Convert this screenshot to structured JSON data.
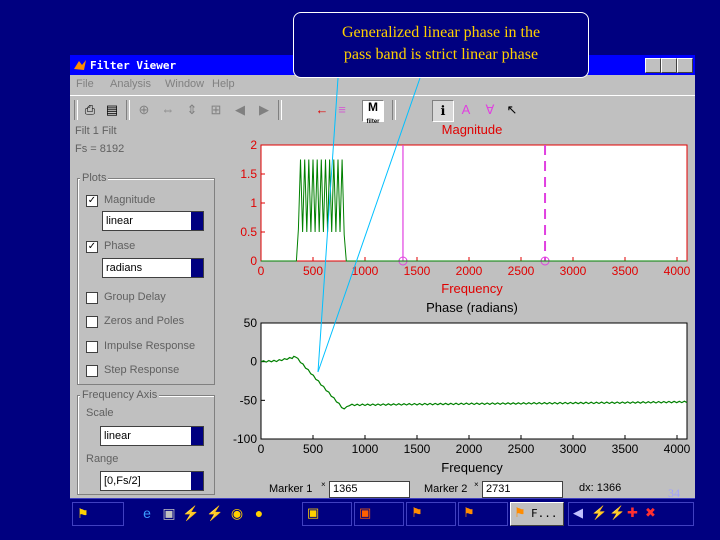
{
  "window": {
    "title": "Filter Viewer",
    "menu": [
      "File",
      "Analysis",
      "Window",
      "Help"
    ]
  },
  "toolbar": {
    "icons": [
      "print-icon",
      "print-preview-icon",
      "zoom-in-icon",
      "zoom-x-icon",
      "zoom-y-icon",
      "full-view-icon",
      "pan-left-icon",
      "pan-right-icon",
      "marker-left-icon",
      "signal-icon",
      "mri-icon",
      "info-icon",
      "marker-a-icon",
      "marker-b-icon",
      "pointer-icon"
    ],
    "mri_label": "M",
    "mri_sub": "filter"
  },
  "left_panel": {
    "filter_name": "Filt 1 Filt",
    "filter_fs": "Fs = 8192",
    "plots_heading": "Plots",
    "magnitude": {
      "label": "Magnitude",
      "checked": true,
      "mode": "linear"
    },
    "phase": {
      "label": "Phase",
      "checked": true,
      "mode": "radians"
    },
    "group_delay": {
      "label": "Group Delay",
      "checked": false
    },
    "zeros_poles": {
      "label": "Zeros and Poles",
      "checked": false
    },
    "impulse": {
      "label": "Impulse Response",
      "checked": false
    },
    "step": {
      "label": "Step Response",
      "checked": false
    },
    "freq_axis_heading": "Frequency Axis",
    "scale_label": "Scale",
    "scale_value": "linear",
    "range_label": "Range",
    "range_value": "[0,Fs/2]"
  },
  "markers": {
    "marker1_label": "Marker 1",
    "marker1_value": "1365",
    "marker2_label": "Marker 2",
    "marker2_value": "2731",
    "dx_label": "dx: 1366"
  },
  "callout": {
    "line1": "Generalized linear phase in the",
    "line2": "pass band is strict linear phase"
  },
  "page_number": "34",
  "taskbar": {
    "active_task": "F...",
    "tray_icons": [
      "speaker-icon",
      "shield-icon",
      "network-icon"
    ]
  },
  "chart_data": [
    {
      "type": "line",
      "title": "Magnitude",
      "xlabel": "Frequency",
      "ylabel": "",
      "xlim": [
        0,
        4096
      ],
      "ylim": [
        0,
        2
      ],
      "xticks": [
        0,
        500,
        1000,
        1500,
        2000,
        2500,
        3000,
        3500,
        4000
      ],
      "yticks": [
        0,
        0.5,
        1,
        1.5,
        2
      ],
      "series": [
        {
          "color": "#008000",
          "x": [
            0,
            340,
            360,
            380,
            400,
            420,
            440,
            460,
            480,
            500,
            520,
            540,
            560,
            580,
            600,
            620,
            640,
            660,
            680,
            700,
            720,
            740,
            760,
            780,
            800,
            820,
            4096
          ],
          "y": [
            0,
            0,
            0.55,
            1.75,
            0.5,
            1.75,
            0.5,
            1.75,
            0.5,
            1.75,
            0.5,
            1.75,
            0.5,
            1.75,
            0.5,
            1.75,
            0.5,
            1.75,
            0.5,
            1.75,
            0.5,
            1.75,
            0.5,
            1.75,
            0.45,
            0,
            0
          ]
        }
      ],
      "markers": [
        {
          "x": 1365,
          "style": "solid",
          "color": "#e040e0"
        },
        {
          "x": 2731,
          "style": "dashed",
          "color": "#e040e0"
        }
      ]
    },
    {
      "type": "line",
      "title": "Phase (radians)",
      "xlabel": "Frequency",
      "ylabel": "",
      "xlim": [
        0,
        4096
      ],
      "ylim": [
        -100,
        50
      ],
      "xticks": [
        0,
        500,
        1000,
        1500,
        2000,
        2500,
        3000,
        3500,
        4000
      ],
      "yticks": [
        -100,
        -50,
        0,
        50
      ],
      "series": [
        {
          "color": "#008000",
          "x": [
            0,
            150,
            300,
            330,
            800,
            850,
            1500,
            2500,
            3500,
            4096
          ],
          "y": [
            0,
            1,
            5,
            7,
            -62,
            -56,
            -55,
            -54,
            -53,
            -52
          ]
        }
      ]
    }
  ]
}
